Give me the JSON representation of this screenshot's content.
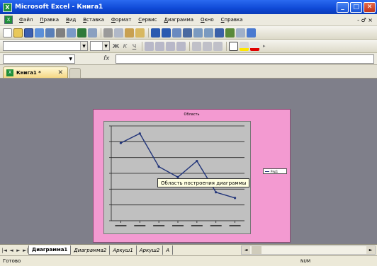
{
  "window": {
    "title": "Microsoft Excel - Книга1"
  },
  "menu": {
    "items": [
      "Файл",
      "Правка",
      "Вид",
      "Вставка",
      "Формат",
      "Сервис",
      "Диаграмма",
      "Окно",
      "Справка"
    ],
    "right": "- ♂ ×"
  },
  "formula_bar": {
    "fx": "fx"
  },
  "doc_tab": {
    "label": "Книга1 *",
    "close": "✕"
  },
  "chart": {
    "title": "Область",
    "tooltip": "Область построения диаграммы",
    "legend_label": "Ряд1"
  },
  "sheet_tabs": {
    "tabs": [
      "Диаграмма1",
      "Диаграмма2",
      "Аркуш1",
      "Аркуш2",
      "А"
    ],
    "active_index": 0
  },
  "status": {
    "left": "Готово",
    "num": "NUM"
  },
  "chart_data": {
    "type": "line",
    "title": "",
    "categories": [
      "",
      "",
      "",
      "",
      "",
      "",
      ""
    ],
    "series": [
      {
        "values": [
          82,
          92,
          57,
          46,
          63,
          30,
          24
        ]
      }
    ],
    "ylim": [
      0,
      100
    ],
    "grid": true,
    "legend": "right"
  },
  "colors": {
    "chart_area": "#f39ad1",
    "plot_area": "#c0c0c0",
    "series_line": "#22357a"
  }
}
